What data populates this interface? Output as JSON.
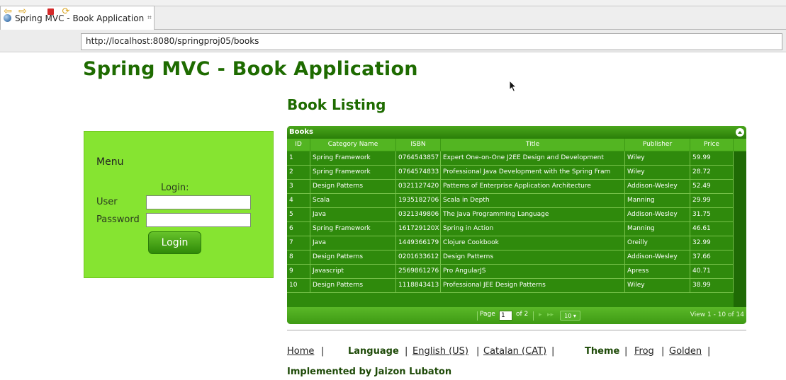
{
  "browser": {
    "tab_title": "Spring MVC - Book Application",
    "tab_close": "⌗",
    "url": "http://localhost:8080/springproj05/books"
  },
  "page": {
    "title": "Spring MVC - Book Application",
    "section_title": "Book Listing"
  },
  "menu": {
    "heading": "Menu",
    "login_label": "Login:",
    "user_label": "User",
    "password_label": "Password",
    "user_value": "",
    "password_value": "",
    "login_button": "Login"
  },
  "grid": {
    "caption": "Books",
    "columns": [
      "ID",
      "Category Name",
      "ISBN",
      "Title",
      "Publisher",
      "Price"
    ],
    "rows": [
      [
        "1",
        "Spring Framework",
        "0764543857",
        "Expert One-on-One J2EE Design and Development",
        "Wiley",
        "59.99"
      ],
      [
        "2",
        "Spring Framework",
        "0764574833",
        "Professional Java Development with the Spring Fram",
        "Wiley",
        "28.72"
      ],
      [
        "3",
        "Design Patterns",
        "0321127420",
        "Patterns of Enterprise Application Architecture",
        "Addison-Wesley",
        "52.49"
      ],
      [
        "4",
        "Scala",
        "1935182706",
        "Scala in Depth",
        "Manning",
        "29.99"
      ],
      [
        "5",
        "Java",
        "0321349806",
        "The Java Programming Language",
        "Addison-Wesley",
        "31.75"
      ],
      [
        "6",
        "Spring Framework",
        "161729120X",
        "Spring in Action",
        "Manning",
        "46.61"
      ],
      [
        "7",
        "Java",
        "1449366179",
        "Clojure Cookbook",
        "Oreilly",
        "32.99"
      ],
      [
        "8",
        "Design Patterns",
        "0201633612",
        "Design Patterns",
        "Addison-Wesley",
        "37.66"
      ],
      [
        "9",
        "Javascript",
        "2569861276",
        "Pro AngularJS",
        "Apress",
        "40.71"
      ],
      [
        "10",
        "Design Patterns",
        "1118843413",
        "Professional JEE Design Patterns",
        "Wiley",
        "38.99"
      ]
    ],
    "pager": {
      "page_label": "Page",
      "page_value": "1",
      "of_label": "of 2",
      "rows_per_page": "10 ▾",
      "view_text": "View 1 - 10 of 14"
    }
  },
  "footer": {
    "home": "Home",
    "language_label": "Language",
    "english": "English (US)",
    "catalan": "Catalan (CAT)",
    "theme_label": "Theme",
    "frog": "Frog",
    "golden": "Golden",
    "sep": "|",
    "implemented": "Implemented by Jaizon Lubaton"
  },
  "colors": {
    "accent": "#1e6b00",
    "menu_bg": "#86e431",
    "grid_bg": "#2e8a0c"
  }
}
